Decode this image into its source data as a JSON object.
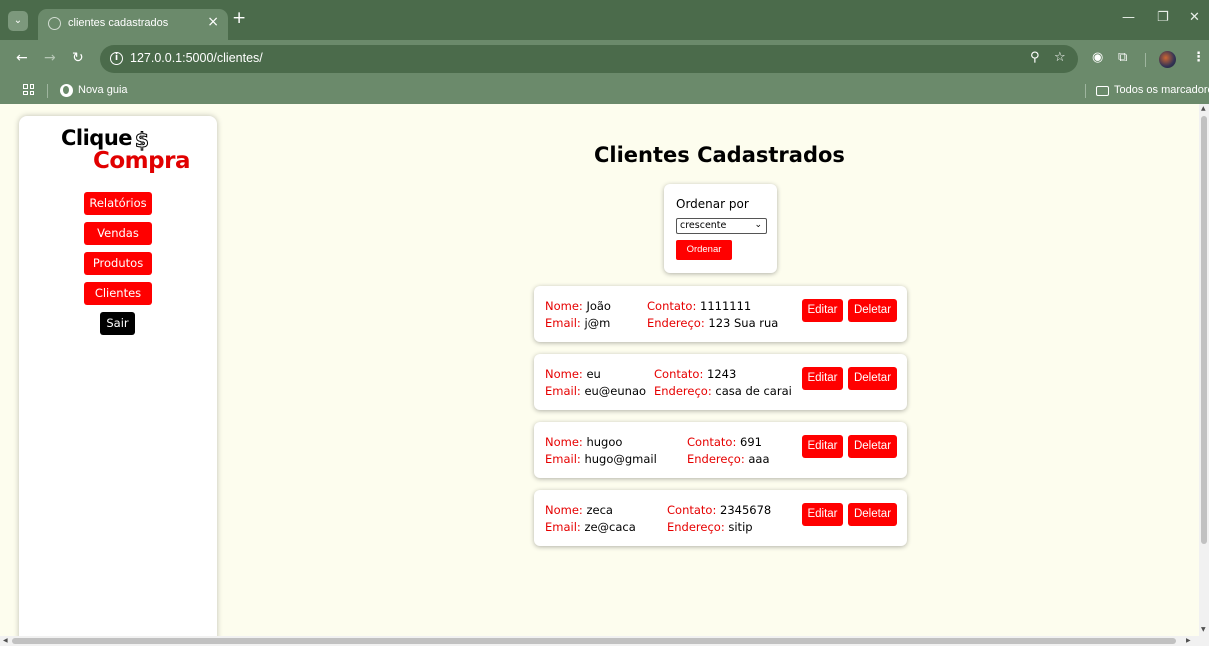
{
  "browser": {
    "tab_title": "clientes cadastrados",
    "tab_close": "×",
    "new_tab": "+",
    "url": "127.0.0.1:5000/clientes/",
    "bookmark_new_tab": "Nova guia",
    "all_bookmarks": "Todos os marcadores",
    "icons": [
      "tab-search-icon",
      "back-icon",
      "forward-icon",
      "reload-icon",
      "info-icon",
      "zoom-icon",
      "star-icon",
      "extension-icon",
      "puzzle-icon",
      "profile-avatar",
      "menu-icon",
      "apps-icon",
      "globe-icon",
      "folder-icon"
    ]
  },
  "sidebar": {
    "logo_line1": "Clique",
    "logo_dollar": "$",
    "logo_line2": "Compra",
    "items": [
      {
        "label": "Relatórios"
      },
      {
        "label": "Vendas"
      },
      {
        "label": "Produtos"
      },
      {
        "label": "Clientes"
      }
    ],
    "logout": "Sair"
  },
  "main": {
    "title": "Clientes Cadastrados",
    "sort": {
      "label": "Ordenar por",
      "selected": "crescente",
      "button": "Ordenar"
    },
    "labels": {
      "name": "Nome:",
      "email": "Email:",
      "contact": "Contato:",
      "address": "Endereço:",
      "edit": "Editar",
      "delete": "Deletar"
    },
    "clients": [
      {
        "nome": "João",
        "email": "j@m",
        "contato": "1111111",
        "endereco": "123 Sua rua"
      },
      {
        "nome": "eu",
        "email": "eu@eunao",
        "contato": "1243",
        "endereco": "casa de carai"
      },
      {
        "nome": "hugoo",
        "email": "hugo@gmail",
        "contato": "691",
        "endereco": "aaa"
      },
      {
        "nome": "zeca",
        "email": "ze@caca",
        "contato": "2345678",
        "endereco": "sitip"
      }
    ]
  },
  "colors": {
    "accent": "#ff0000",
    "label_red": "#e60000",
    "page_bg": "#fdfdee",
    "chrome": "#6b8a6b",
    "chrome_dark": "#4b6b4b"
  }
}
